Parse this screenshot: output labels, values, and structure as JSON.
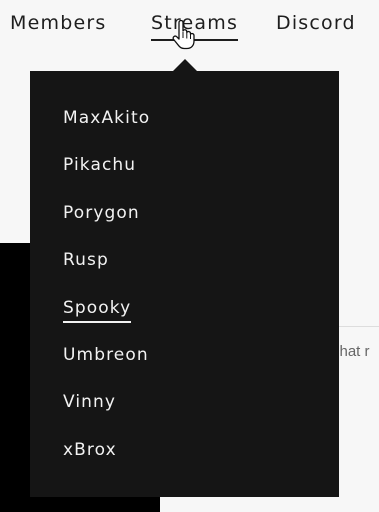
{
  "nav": {
    "items": [
      {
        "label": "Members"
      },
      {
        "label": "Streams"
      },
      {
        "label": "Discord"
      }
    ],
    "active": "Streams"
  },
  "dropdown": {
    "items": [
      {
        "label": "MaxAkito"
      },
      {
        "label": "Pikachu"
      },
      {
        "label": "Porygon"
      },
      {
        "label": "Rusp"
      },
      {
        "label": "Spooky"
      },
      {
        "label": "Umbreon"
      },
      {
        "label": "Vinny"
      },
      {
        "label": "xBrox"
      }
    ],
    "selected": "Spooky"
  },
  "background": {
    "chat_hint": "chat r"
  },
  "cursor": {
    "icon": "hand-pointer-icon"
  },
  "colors": {
    "page_background": "#f7f7f7",
    "nav_text": "#1e1e1e",
    "dropdown_background": "#151515",
    "dropdown_text": "#f2f2f2",
    "embed_background": "#000000"
  }
}
